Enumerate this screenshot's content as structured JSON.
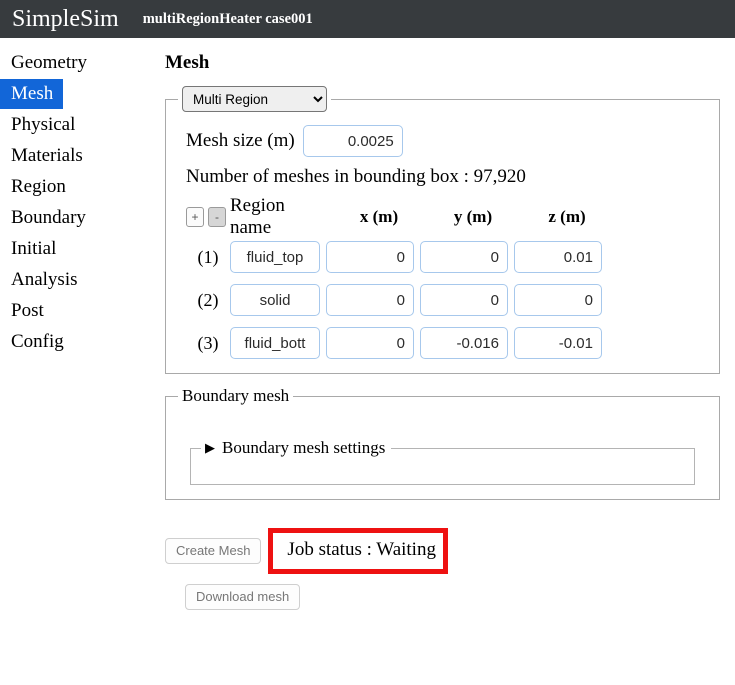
{
  "header": {
    "brand": "SimpleSim",
    "case_title": "multiRegionHeater case001",
    "background_color": "#373b3e"
  },
  "sidebar": {
    "active_index": 1,
    "active_color": "#1266d8",
    "items": [
      {
        "label": "Geometry"
      },
      {
        "label": "Mesh"
      },
      {
        "label": "Physical"
      },
      {
        "label": "Materials"
      },
      {
        "label": "Region"
      },
      {
        "label": "Boundary"
      },
      {
        "label": "Initial"
      },
      {
        "label": "Analysis"
      },
      {
        "label": "Post"
      },
      {
        "label": "Config"
      }
    ]
  },
  "main": {
    "page_title": "Mesh",
    "mesh_panel": {
      "region_mode": "Multi Region",
      "region_mode_options": [
        "Multi Region"
      ],
      "mesh_size_label": "Mesh size (m)",
      "mesh_size_value": "0.0025",
      "mesh_count_line": "Number of meshes in bounding box : 97,920",
      "add_row_label": "+",
      "remove_row_label": "-",
      "columns": {
        "name": "Region name",
        "x": "x (m)",
        "y": "y (m)",
        "z": "z (m)"
      },
      "rows": [
        {
          "index": "(1)",
          "name": "fluid_top",
          "x": "0",
          "y": "0",
          "z": "0.01"
        },
        {
          "index": "(2)",
          "name": "solid",
          "x": "0",
          "y": "0",
          "z": "0"
        },
        {
          "index": "(3)",
          "name": "fluid_bott",
          "x": "0",
          "y": "-0.016",
          "z": "-0.01"
        }
      ]
    },
    "boundary_panel": {
      "legend": "Boundary mesh",
      "settings_legend": "Boundary mesh settings",
      "settings_expanded": false,
      "disclosure_glyph": "▶"
    },
    "actions": {
      "create_mesh": "Create Mesh",
      "job_status": "Job status : Waiting",
      "job_status_highlight_color": "#ee1111",
      "download_mesh": "Download mesh"
    }
  }
}
